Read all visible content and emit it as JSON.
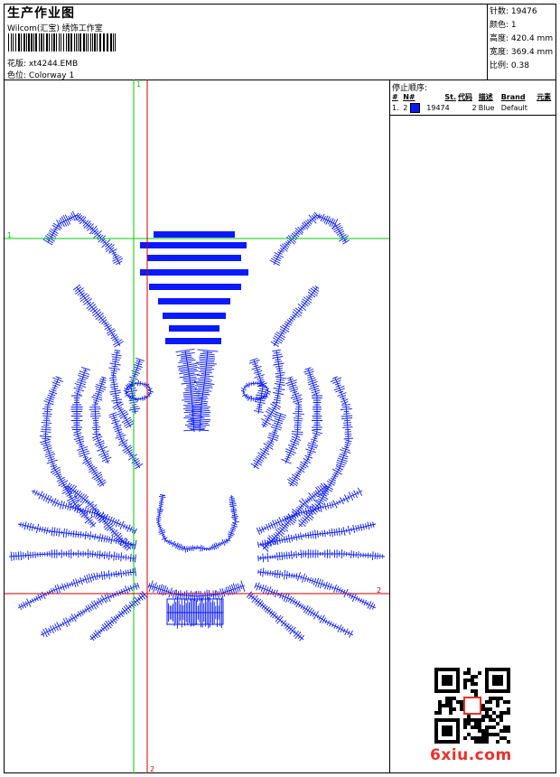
{
  "header": {
    "title": "生产作业图",
    "company": "Wilcom(汇宝) 绣饰工作室",
    "design_label": "花版:",
    "design_value": "xt4244.EMB",
    "colorway_label": "色位:",
    "colorway_value": "Colorway 1"
  },
  "stats": [
    {
      "label": "针数:",
      "value": "19476"
    },
    {
      "label": "颜色:",
      "value": "1"
    },
    {
      "label": "高度:",
      "value": "420.4 mm"
    },
    {
      "label": "宽度:",
      "value": "369.4 mm"
    },
    {
      "label": "比例:",
      "value": "0.38"
    }
  ],
  "stop_sequence": {
    "title": "停止顺序:",
    "columns": [
      "#",
      "N#",
      "St.",
      "代码",
      "描述",
      "Brand",
      "元素"
    ],
    "rows": [
      {
        "index": "1.",
        "needle": "2",
        "color": "#0a1aff",
        "stitches": "19474",
        "code": "2",
        "description": "Blue",
        "brand": "Default",
        "element": ""
      }
    ]
  },
  "guides": {
    "label_1": "1",
    "label_2": "2",
    "green": "#00cc00",
    "red": "#cc0000"
  },
  "design": {
    "thread_color": "#0a1aff"
  },
  "watermark": {
    "brand": "6xiu.com",
    "color": "#e8322b"
  }
}
